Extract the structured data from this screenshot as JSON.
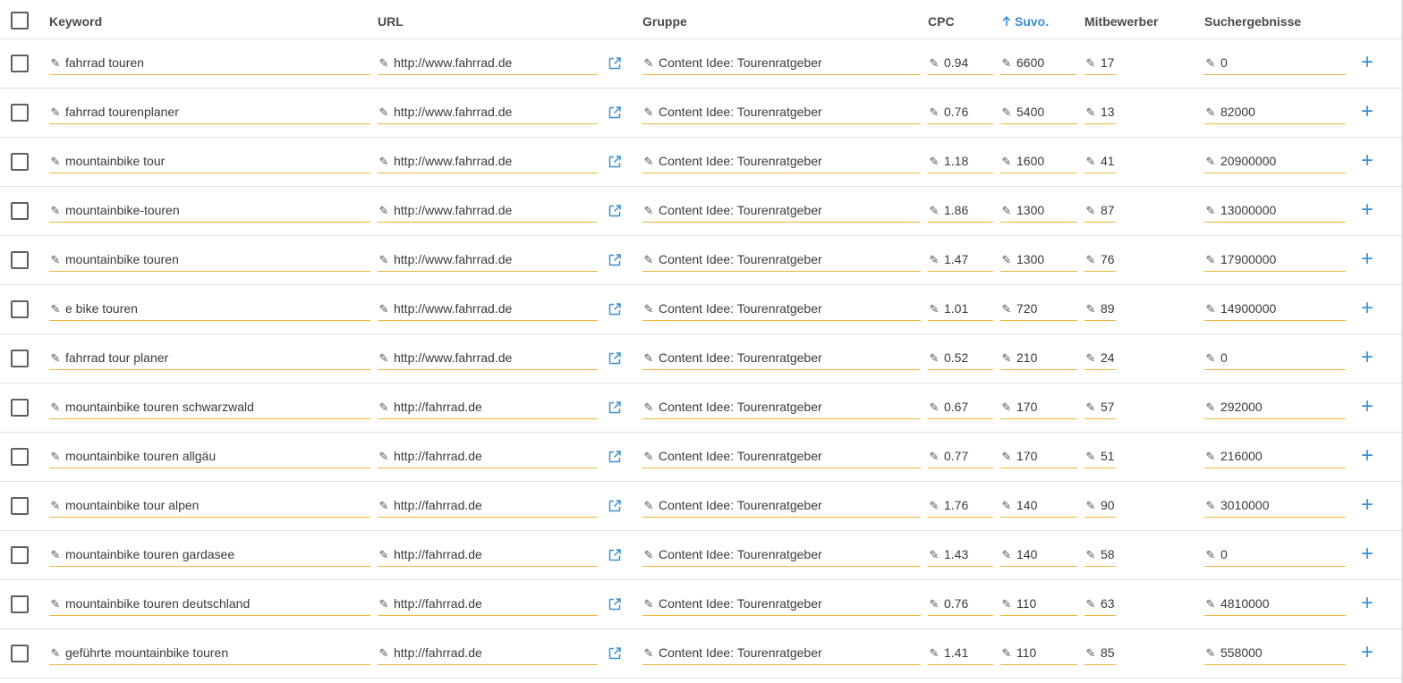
{
  "colors": {
    "accent": "#3b8fd1",
    "underline": "#f0b53c"
  },
  "header": {
    "keyword": "Keyword",
    "url": "URL",
    "gruppe": "Gruppe",
    "cpc": "CPC",
    "suvo": "Suvo.",
    "mitbewerber": "Mitbewerber",
    "suchergebnisse": "Suchergebnisse",
    "sort_icon": "arrow-up-icon"
  },
  "rows": [
    {
      "keyword": "fahrrad touren",
      "url": "http://www.fahrrad.de",
      "gruppe": "Content Idee: Tourenratgeber",
      "cpc": "0.94",
      "suvo": "6600",
      "mitbewerber": "17 %",
      "suchergebnisse": "0"
    },
    {
      "keyword": "fahrrad tourenplaner",
      "url": "http://www.fahrrad.de",
      "gruppe": "Content Idee: Tourenratgeber",
      "cpc": "0.76",
      "suvo": "5400",
      "mitbewerber": "13 %",
      "suchergebnisse": "82000"
    },
    {
      "keyword": "mountainbike tour",
      "url": "http://www.fahrrad.de",
      "gruppe": "Content Idee: Tourenratgeber",
      "cpc": "1.18",
      "suvo": "1600",
      "mitbewerber": "41 %",
      "suchergebnisse": "20900000"
    },
    {
      "keyword": "mountainbike-touren",
      "url": "http://www.fahrrad.de",
      "gruppe": "Content Idee: Tourenratgeber",
      "cpc": "1.86",
      "suvo": "1300",
      "mitbewerber": "87 %",
      "suchergebnisse": "13000000"
    },
    {
      "keyword": "mountainbike touren",
      "url": "http://www.fahrrad.de",
      "gruppe": "Content Idee: Tourenratgeber",
      "cpc": "1.47",
      "suvo": "1300",
      "mitbewerber": "76 %",
      "suchergebnisse": "17900000"
    },
    {
      "keyword": "e bike touren",
      "url": "http://www.fahrrad.de",
      "gruppe": "Content Idee: Tourenratgeber",
      "cpc": "1.01",
      "suvo": "720",
      "mitbewerber": "89 %",
      "suchergebnisse": "14900000"
    },
    {
      "keyword": "fahrrad tour planer",
      "url": "http://www.fahrrad.de",
      "gruppe": "Content Idee: Tourenratgeber",
      "cpc": "0.52",
      "suvo": "210",
      "mitbewerber": "24 %",
      "suchergebnisse": "0"
    },
    {
      "keyword": "mountainbike touren schwarzwald",
      "url": "http://fahrrad.de",
      "gruppe": "Content Idee: Tourenratgeber",
      "cpc": "0.67",
      "suvo": "170",
      "mitbewerber": "57 %",
      "suchergebnisse": "292000"
    },
    {
      "keyword": "mountainbike touren allgäu",
      "url": "http://fahrrad.de",
      "gruppe": "Content Idee: Tourenratgeber",
      "cpc": "0.77",
      "suvo": "170",
      "mitbewerber": "51 %",
      "suchergebnisse": "216000"
    },
    {
      "keyword": "mountainbike tour alpen",
      "url": "http://fahrrad.de",
      "gruppe": "Content Idee: Tourenratgeber",
      "cpc": "1.76",
      "suvo": "140",
      "mitbewerber": "90 %",
      "suchergebnisse": "3010000"
    },
    {
      "keyword": "mountainbike touren gardasee",
      "url": "http://fahrrad.de",
      "gruppe": "Content Idee: Tourenratgeber",
      "cpc": "1.43",
      "suvo": "140",
      "mitbewerber": "58 %",
      "suchergebnisse": "0"
    },
    {
      "keyword": "mountainbike touren deutschland",
      "url": "http://fahrrad.de",
      "gruppe": "Content Idee: Tourenratgeber",
      "cpc": "0.76",
      "suvo": "110",
      "mitbewerber": "63 %",
      "suchergebnisse": "4810000"
    },
    {
      "keyword": "geführte mountainbike touren",
      "url": "http://fahrrad.de",
      "gruppe": "Content Idee: Tourenratgeber",
      "cpc": "1.41",
      "suvo": "110",
      "mitbewerber": "85 %",
      "suchergebnisse": "558000"
    }
  ]
}
